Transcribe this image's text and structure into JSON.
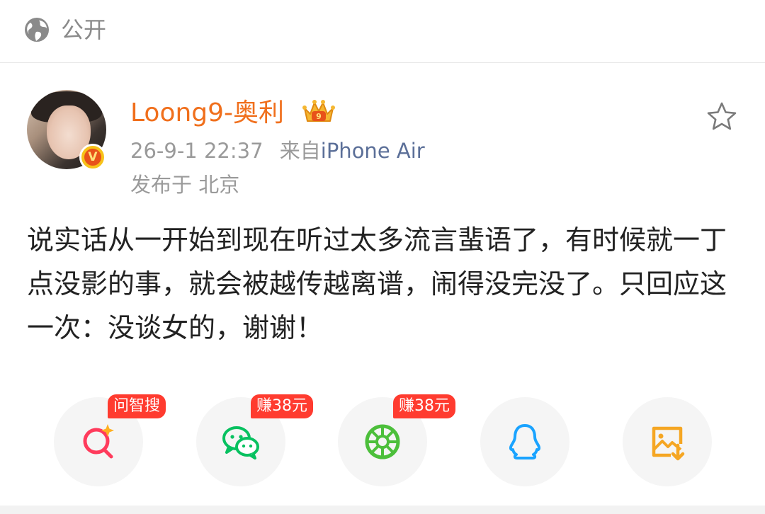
{
  "visibility": {
    "icon": "globe-icon",
    "label": "公开"
  },
  "post": {
    "author": "Loong9-奥利",
    "badge_icon": "verified-v-icon",
    "crown_icon": "crown-icon",
    "timestamp": "26-9-1 22:37",
    "source_prefix": "来自",
    "source_device": "iPhone Air",
    "location": "发布于 北京",
    "favorite_icon": "star-icon",
    "text": "说实话从一开始到现在听过太多流言蜚语了，有时候就一丁点没影的事，就会被越传越离谱，闹得没完没了。只回应这一次：没谈女的，谢谢！"
  },
  "share": {
    "buttons": [
      {
        "icon": "ai-search-icon",
        "tag": "问智搜"
      },
      {
        "icon": "wechat-icon",
        "tag": "赚38元"
      },
      {
        "icon": "moments-icon",
        "tag": "赚38元"
      },
      {
        "icon": "qq-icon",
        "tag": ""
      },
      {
        "icon": "save-image-icon",
        "tag": ""
      }
    ]
  },
  "colors": {
    "author": "#f06f1c",
    "source_link": "#5b6f98",
    "tag_bg": "#ff3b2f",
    "search": "#ff3b5c",
    "wechat": "#07c160",
    "moments": "#4cbf3b",
    "qq": "#1aa3ff",
    "save": "#f5a623"
  }
}
